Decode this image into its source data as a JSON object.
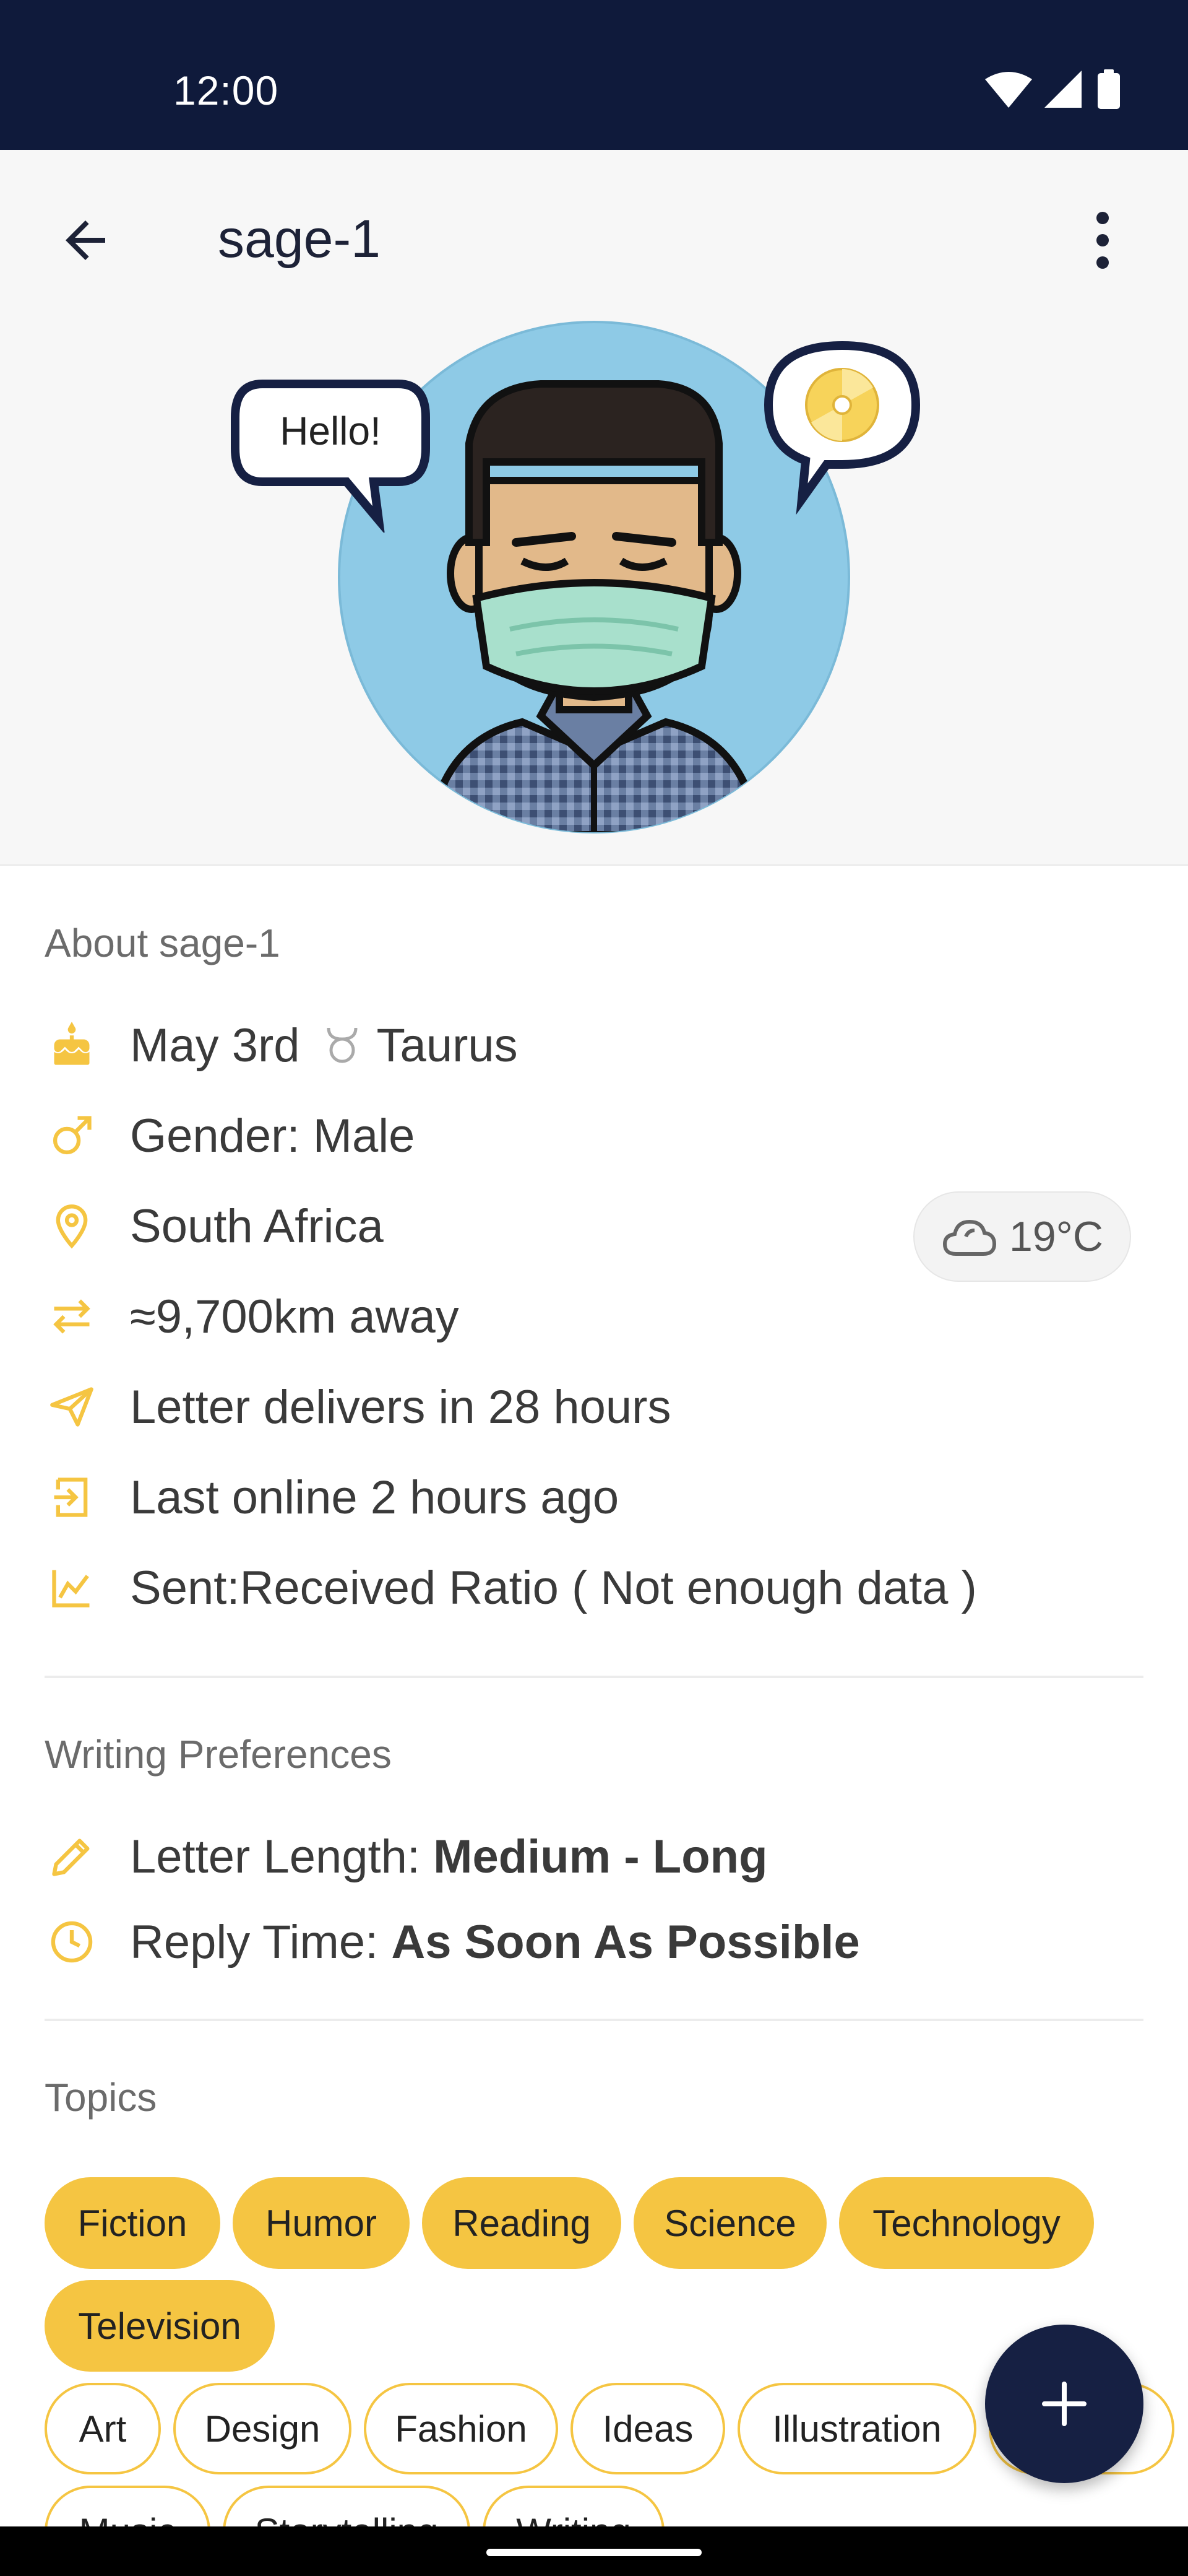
{
  "status_bar": {
    "time": "12:00",
    "icons": [
      "wifi-icon",
      "signal-icon",
      "battery-icon"
    ]
  },
  "app_bar": {
    "title": "sage-1",
    "back_icon": "arrow-back-icon",
    "menu_icon": "more-vert-icon"
  },
  "avatar": {
    "bubble_text": "Hello!",
    "bubble_icon": "disc-icon"
  },
  "about": {
    "title": "About sage-1",
    "rows": [
      {
        "icon": "cake-icon",
        "text": "May 3rd",
        "extra_icon": "taurus-icon",
        "extra": "Taurus"
      },
      {
        "icon": "male-icon",
        "text": "Gender: Male"
      },
      {
        "icon": "location-pin-icon",
        "text": "South Africa"
      },
      {
        "icon": "swap-arrows-icon",
        "text": "≈9,700km away"
      },
      {
        "icon": "send-icon",
        "text": "Letter delivers in 28 hours"
      },
      {
        "icon": "login-icon",
        "text": "Last online 2 hours ago"
      },
      {
        "icon": "chart-icon",
        "text": "Sent:Received Ratio ( Not enough data )"
      }
    ],
    "weather": {
      "icon": "cloud-icon",
      "temp": "19°C"
    }
  },
  "writing": {
    "title": "Writing Preferences",
    "length_label": "Letter Length: ",
    "length_value": "Medium - Long",
    "reply_label": "Reply Time: ",
    "reply_value": "As Soon As Possible"
  },
  "topics": {
    "title": "Topics",
    "selected": [
      "Fiction",
      "Humor",
      "Reading",
      "Science",
      "Technology",
      "Television"
    ],
    "other": [
      "Art",
      "Design",
      "Fashion",
      "Ideas",
      "Illustration",
      "Music",
      "Storytelling",
      "Writing"
    ]
  },
  "fab": {
    "icon": "plus-icon"
  },
  "colors": {
    "accent": "#f5c542",
    "navy": "#162043",
    "status_bar": "#0f1a3b"
  }
}
